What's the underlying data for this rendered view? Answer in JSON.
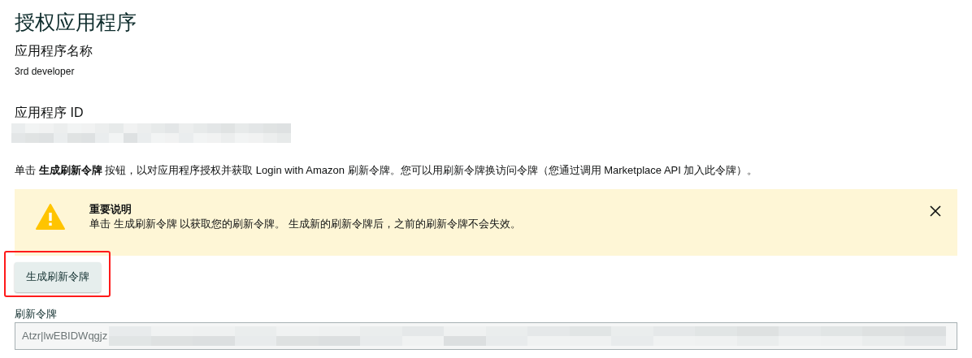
{
  "title": "授权应用程序",
  "app_name": {
    "label": "应用程序名称",
    "value": "3rd developer"
  },
  "app_id": {
    "label": "应用程序 ID",
    "redacted": true
  },
  "instructions": "单击 **生成刷新令牌** 按钮，以对应用程序授权并获取 Login with Amazon 刷新令牌。您可以用刷新令牌换访问令牌（您通过调用 Marketplace API 加入此令牌）。",
  "alert": {
    "kind": "warning",
    "title": "重要说明",
    "message": "单击 生成刷新令牌 以获取您的刷新令牌。 生成新的刷新令牌后，之前的刷新令牌不会失效。",
    "close": true
  },
  "button": {
    "label": "生成刷新令牌",
    "highlighted": true
  },
  "refresh_token": {
    "label": "刷新令牌",
    "value": "Atzr|lwEBIDWqgjz",
    "redacted": true
  }
}
